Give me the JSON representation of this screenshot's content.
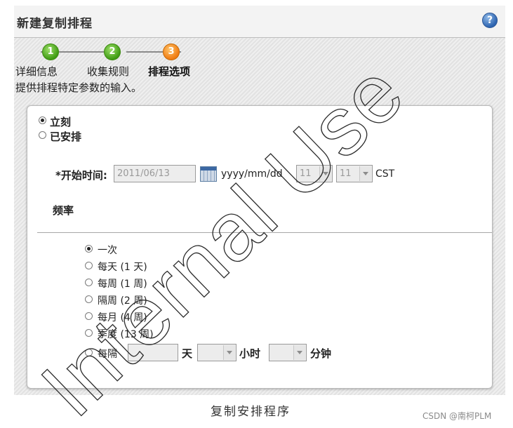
{
  "dialog": {
    "title": "新建复制排程",
    "help_icon_glyph": "?"
  },
  "wizard": {
    "steps": [
      {
        "number": "1",
        "label": "详细信息",
        "state": "completed",
        "color": "#4aa31a"
      },
      {
        "number": "2",
        "label": "收集规则",
        "state": "completed",
        "color": "#4aa31a"
      },
      {
        "number": "3",
        "label": "排程选项",
        "state": "current",
        "color": "#f0861a"
      }
    ],
    "instruction": "提供排程特定参数的输入。"
  },
  "schedule": {
    "immediate_label": "立刻",
    "scheduled_label": "已安排",
    "selected": "immediate",
    "start_time_label": "*开始时间:",
    "date_value": "2011/06/13",
    "date_format": "yyyy/mm/dd",
    "hour_value": "11",
    "minute_value": "11",
    "timezone": "CST"
  },
  "frequency": {
    "heading": "频率",
    "options": [
      {
        "label": "一次",
        "selected": true
      },
      {
        "label": "每天 (1 天)",
        "selected": false
      },
      {
        "label": "每周 (1 周)",
        "selected": false
      },
      {
        "label": "隔周 (2 周)",
        "selected": false
      },
      {
        "label": "每月 (4 周)",
        "selected": false
      },
      {
        "label": "季度 (13 周)",
        "selected": false
      }
    ],
    "custom": {
      "label": "每隔",
      "days_unit": "天",
      "hours_unit": "小时",
      "minutes_unit": "分钟"
    }
  },
  "caption": "复制安排程序",
  "credit": "CSDN @南柯PLM",
  "watermark": "Internal Use"
}
